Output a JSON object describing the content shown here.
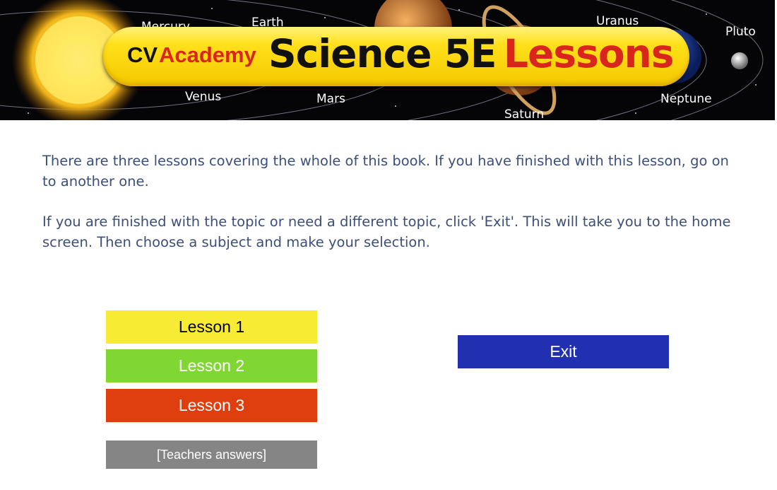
{
  "banner": {
    "brand_cv": "CV",
    "brand_academy": "Academy",
    "title_science": "Science 5E",
    "title_lessons": "Lessons",
    "planets": {
      "mercury": "Mercury",
      "earth": "Earth",
      "uranus": "Uranus",
      "pluto": "Pluto",
      "venus": "Venus",
      "mars": "Mars",
      "saturn": "Saturn",
      "neptune": "Neptune"
    }
  },
  "content": {
    "paragraph1": "There are three lessons covering the whole of this book. If you have finished with this lesson, go on to another one.",
    "paragraph2": "If you are finished with the topic or need a different topic, click 'Exit'. This will take you to the home screen. Then choose a subject and make your selection."
  },
  "buttons": {
    "lesson1": "Lesson 1",
    "lesson2": "Lesson 2",
    "lesson3": "Lesson 3",
    "teachers_answers": "[Teachers answers]",
    "exit": "Exit"
  },
  "colors": {
    "lesson1": "#f7ec33",
    "lesson2": "#80d733",
    "lesson3": "#df3e0e",
    "teachers_answers": "#858585",
    "exit": "#2030b0",
    "body_text": "#3c4f7a",
    "brand_red": "#d9261c"
  }
}
